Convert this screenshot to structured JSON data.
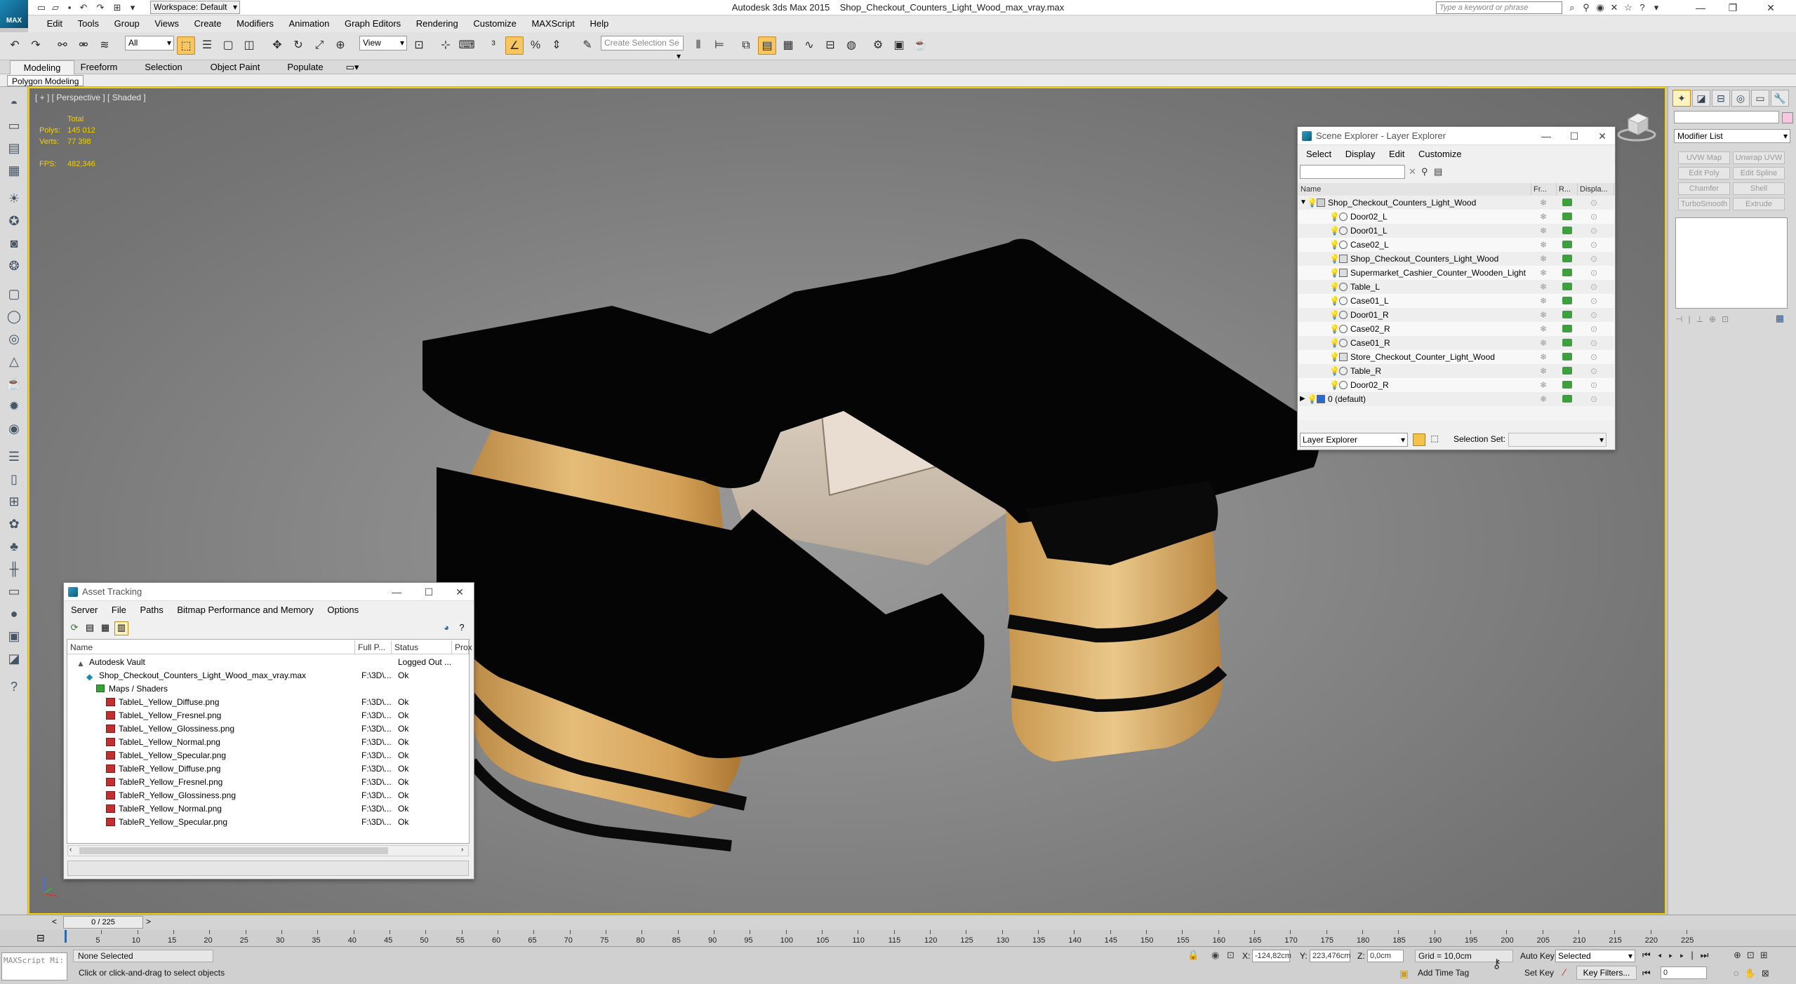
{
  "app": {
    "title": "Autodesk 3ds Max  2015",
    "file": "Shop_Checkout_Counters_Light_Wood_max_vray.max",
    "logo": "MAX",
    "workspace": "Workspace: Default",
    "search_placeholder": "Type a keyword or phrase"
  },
  "menus": [
    "Edit",
    "Tools",
    "Group",
    "Views",
    "Create",
    "Modifiers",
    "Animation",
    "Graph Editors",
    "Rendering",
    "Customize",
    "MAXScript",
    "Help"
  ],
  "toolbar": {
    "filter": "All",
    "ref_coord": "View",
    "selection_set_placeholder": "Create Selection Se"
  },
  "ribbon": {
    "tabs": [
      "Modeling",
      "Freeform",
      "Selection",
      "Object Paint",
      "Populate"
    ],
    "panel_button": "Polygon Modeling"
  },
  "viewport": {
    "label": "[ + ] [ Perspective ] [ Shaded ]",
    "stats": {
      "total_label": "Total",
      "polys_label": "Polys:",
      "polys": "145 012",
      "verts_label": "Verts:",
      "verts": "77 398",
      "fps_label": "FPS:",
      "fps": "482,346"
    }
  },
  "scene_explorer": {
    "title": "Scene Explorer - Layer Explorer",
    "menus": [
      "Select",
      "Display",
      "Edit",
      "Customize"
    ],
    "columns": [
      "Name",
      "Fr...",
      "R...",
      "Displa..."
    ],
    "rows": [
      {
        "name": "Shop_Checkout_Counters_Light_Wood",
        "level": 0,
        "kind": "layer"
      },
      {
        "name": "Door02_L",
        "level": 1,
        "kind": "object"
      },
      {
        "name": "Door01_L",
        "level": 1,
        "kind": "object"
      },
      {
        "name": "Case02_L",
        "level": 1,
        "kind": "object"
      },
      {
        "name": "Shop_Checkout_Counters_Light_Wood",
        "level": 1,
        "kind": "group"
      },
      {
        "name": "Supermarket_Cashier_Counter_Wooden_Light",
        "level": 1,
        "kind": "group"
      },
      {
        "name": "Table_L",
        "level": 1,
        "kind": "object"
      },
      {
        "name": "Case01_L",
        "level": 1,
        "kind": "object"
      },
      {
        "name": "Door01_R",
        "level": 1,
        "kind": "object"
      },
      {
        "name": "Case02_R",
        "level": 1,
        "kind": "object"
      },
      {
        "name": "Case01_R",
        "level": 1,
        "kind": "object"
      },
      {
        "name": "Store_Checkout_Counter_Light_Wood",
        "level": 1,
        "kind": "group"
      },
      {
        "name": "Table_R",
        "level": 1,
        "kind": "object"
      },
      {
        "name": "Door02_R",
        "level": 1,
        "kind": "object"
      },
      {
        "name": "0 (default)",
        "level": 0,
        "kind": "layer-default"
      }
    ],
    "footer_mode": "Layer Explorer",
    "selection_set_label": "Selection Set:"
  },
  "asset_tracking": {
    "title": "Asset Tracking",
    "menus": [
      "Server",
      "File",
      "Paths",
      "Bitmap Performance and Memory",
      "Options"
    ],
    "columns": [
      "Name",
      "Full P...",
      "Status",
      "Prox"
    ],
    "rows": [
      {
        "name": "Autodesk Vault",
        "path": "",
        "status": "Logged Out ...",
        "indent": 1,
        "kind": "vault"
      },
      {
        "name": "Shop_Checkout_Counters_Light_Wood_max_vray.max",
        "path": "F:\\3D\\...",
        "status": "Ok",
        "indent": 2,
        "kind": "max"
      },
      {
        "name": "Maps / Shaders",
        "path": "",
        "status": "",
        "indent": 3,
        "kind": "folder"
      },
      {
        "name": "TableL_Yellow_Diffuse.png",
        "path": "F:\\3D\\...",
        "status": "Ok",
        "indent": 4,
        "kind": "file"
      },
      {
        "name": "TableL_Yellow_Fresnel.png",
        "path": "F:\\3D\\...",
        "status": "Ok",
        "indent": 4,
        "kind": "file"
      },
      {
        "name": "TableL_Yellow_Glossiness.png",
        "path": "F:\\3D\\...",
        "status": "Ok",
        "indent": 4,
        "kind": "file"
      },
      {
        "name": "TableL_Yellow_Normal.png",
        "path": "F:\\3D\\...",
        "status": "Ok",
        "indent": 4,
        "kind": "file"
      },
      {
        "name": "TableL_Yellow_Specular.png",
        "path": "F:\\3D\\...",
        "status": "Ok",
        "indent": 4,
        "kind": "file"
      },
      {
        "name": "TableR_Yellow_Diffuse.png",
        "path": "F:\\3D\\...",
        "status": "Ok",
        "indent": 4,
        "kind": "file"
      },
      {
        "name": "TableR_Yellow_Fresnel.png",
        "path": "F:\\3D\\...",
        "status": "Ok",
        "indent": 4,
        "kind": "file"
      },
      {
        "name": "TableR_Yellow_Glossiness.png",
        "path": "F:\\3D\\...",
        "status": "Ok",
        "indent": 4,
        "kind": "file"
      },
      {
        "name": "TableR_Yellow_Normal.png",
        "path": "F:\\3D\\...",
        "status": "Ok",
        "indent": 4,
        "kind": "file"
      },
      {
        "name": "TableR_Yellow_Specular.png",
        "path": "F:\\3D\\...",
        "status": "Ok",
        "indent": 4,
        "kind": "file"
      }
    ]
  },
  "command_panel": {
    "modifier_list": "Modifier List",
    "buttons": [
      "UVW Map",
      "Unwrap UVW",
      "Edit Poly",
      "Edit Spline",
      "Chamfer",
      "Shell",
      "TurboSmooth",
      "Extrude"
    ]
  },
  "timeline": {
    "frame": "0 / 225",
    "ticks": [
      "5",
      "10",
      "15",
      "20",
      "25",
      "30",
      "35",
      "40",
      "45",
      "50",
      "55",
      "60",
      "65",
      "70",
      "75",
      "80",
      "85",
      "90",
      "95",
      "100",
      "105",
      "110",
      "115",
      "120",
      "125",
      "130",
      "135",
      "140",
      "145",
      "150",
      "155",
      "160",
      "165",
      "170",
      "175",
      "180",
      "185",
      "190",
      "195",
      "200",
      "205",
      "210",
      "215",
      "220",
      "225"
    ]
  },
  "status": {
    "maxscript": "MAXScript Mi:",
    "selection": "None Selected",
    "prompt": "Click or click-and-drag to select objects",
    "x_label": "X:",
    "x": "-124,82cm",
    "y_label": "Y:",
    "y": "223,476cm",
    "z_label": "Z:",
    "z": "0,0cm",
    "grid": "Grid = 10,0cm",
    "add_time_tag": "Add Time Tag",
    "auto_key": "Auto Key",
    "set_key": "Set Key",
    "key_mode": "Selected",
    "key_filters": "Key Filters...",
    "current_frame": "0"
  },
  "colors": {
    "viewport_border": "#f3d000",
    "stats": "#f5d000",
    "wood": "#d8a860",
    "counter_top": "#050505"
  }
}
